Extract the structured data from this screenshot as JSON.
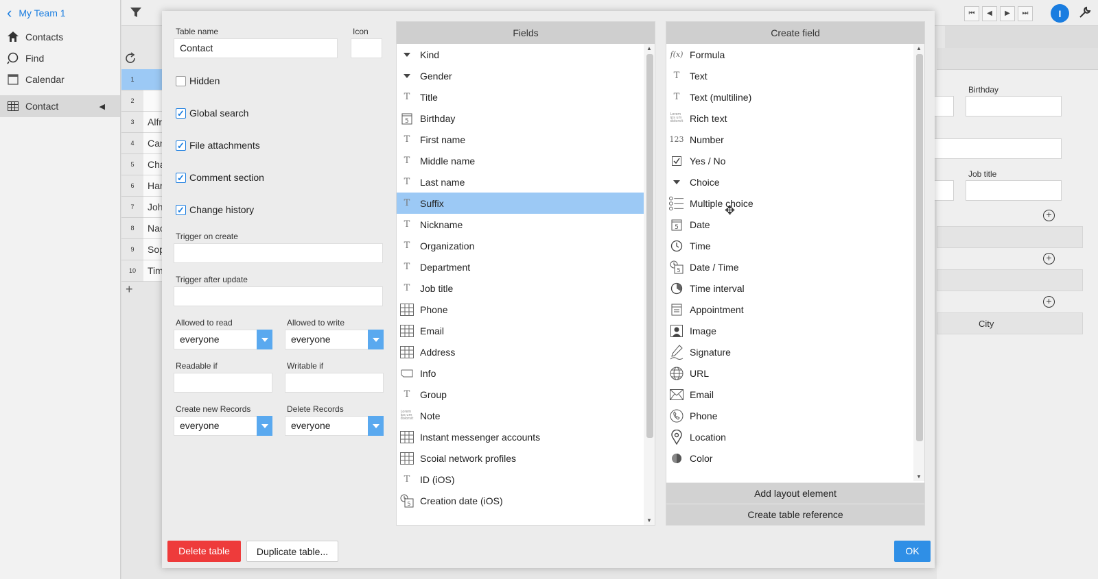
{
  "sidebar": {
    "back_label": "My Team 1",
    "items": [
      {
        "label": "Contacts",
        "icon": "home-icon"
      },
      {
        "label": "Find",
        "icon": "search-icon"
      },
      {
        "label": "Calendar",
        "icon": "calendar-icon"
      }
    ],
    "active_item": {
      "label": "Contact",
      "icon": "table-icon"
    }
  },
  "grid": {
    "rows": [
      {
        "num": "1",
        "text": ""
      },
      {
        "num": "2",
        "text": ""
      },
      {
        "num": "3",
        "text": "Alfr"
      },
      {
        "num": "4",
        "text": "Car"
      },
      {
        "num": "5",
        "text": "Cha"
      },
      {
        "num": "6",
        "text": "Har"
      },
      {
        "num": "7",
        "text": "Joh"
      },
      {
        "num": "8",
        "text": "Nac"
      },
      {
        "num": "9",
        "text": "Sop"
      },
      {
        "num": "10",
        "text": "Tim"
      }
    ],
    "add_label": "+"
  },
  "right_panel": {
    "birthday_label": "Birthday",
    "job_title_label": "Job title",
    "city_label": "City"
  },
  "top_bar": {
    "user_initial": "I"
  },
  "dialog": {
    "table_name_label": "Table name",
    "table_name_value": "Contact",
    "icon_label": "Icon",
    "hidden_label": "Hidden",
    "global_search_label": "Global search",
    "file_attachments_label": "File attachments",
    "comment_section_label": "Comment section",
    "change_history_label": "Change history",
    "trigger_on_create_label": "Trigger on create",
    "trigger_after_update_label": "Trigger after update",
    "allowed_to_read_label": "Allowed to read",
    "allowed_to_read_value": "everyone",
    "allowed_to_write_label": "Allowed to write",
    "allowed_to_write_value": "everyone",
    "readable_if_label": "Readable if",
    "writable_if_label": "Writable if",
    "create_new_records_label": "Create new Records",
    "create_new_records_value": "everyone",
    "delete_records_label": "Delete Records",
    "delete_records_value": "everyone",
    "fields_header": "Fields",
    "fields": [
      {
        "label": "Kind",
        "icon": "choice-arrow-icon"
      },
      {
        "label": "Gender",
        "icon": "choice-arrow-icon"
      },
      {
        "label": "Title",
        "icon": "text-icon"
      },
      {
        "label": "Birthday",
        "icon": "date-icon"
      },
      {
        "label": "First name",
        "icon": "text-icon"
      },
      {
        "label": "Middle name",
        "icon": "text-icon"
      },
      {
        "label": "Last name",
        "icon": "text-icon"
      },
      {
        "label": "Suffix",
        "icon": "text-icon",
        "selected": true
      },
      {
        "label": "Nickname",
        "icon": "text-icon"
      },
      {
        "label": "Organization",
        "icon": "text-icon"
      },
      {
        "label": "Department",
        "icon": "text-icon"
      },
      {
        "label": "Job title",
        "icon": "text-icon"
      },
      {
        "label": "Phone",
        "icon": "table-icon"
      },
      {
        "label": "Email",
        "icon": "table-icon"
      },
      {
        "label": "Address",
        "icon": "table-icon"
      },
      {
        "label": "Info",
        "icon": "info-icon"
      },
      {
        "label": "Group",
        "icon": "text-icon"
      },
      {
        "label": "Note",
        "icon": "rich-text-icon"
      },
      {
        "label": "Instant messenger accounts",
        "icon": "table-icon"
      },
      {
        "label": "Scoial network profiles",
        "icon": "table-icon"
      },
      {
        "label": "ID (iOS)",
        "icon": "text-icon"
      },
      {
        "label": "Creation date (iOS)",
        "icon": "date-time-icon"
      }
    ],
    "create_field_header": "Create field",
    "create_fields": [
      {
        "label": "Formula",
        "icon": "formula-icon"
      },
      {
        "label": "Text",
        "icon": "text-icon"
      },
      {
        "label": "Text (multiline)",
        "icon": "text-icon"
      },
      {
        "label": "Rich text",
        "icon": "rich-text-icon"
      },
      {
        "label": "Number",
        "icon": "number-icon"
      },
      {
        "label": "Yes / No",
        "icon": "checkbox-icon"
      },
      {
        "label": "Choice",
        "icon": "choice-arrow-icon"
      },
      {
        "label": "Multiple choice",
        "icon": "multiple-choice-icon"
      },
      {
        "label": "Date",
        "icon": "date-icon"
      },
      {
        "label": "Time",
        "icon": "clock-icon"
      },
      {
        "label": "Date / Time",
        "icon": "date-time-icon"
      },
      {
        "label": "Time interval",
        "icon": "time-interval-icon"
      },
      {
        "label": "Appointment",
        "icon": "appointment-icon"
      },
      {
        "label": "Image",
        "icon": "image-icon"
      },
      {
        "label": "Signature",
        "icon": "signature-icon"
      },
      {
        "label": "URL",
        "icon": "globe-icon"
      },
      {
        "label": "Email",
        "icon": "envelope-icon"
      },
      {
        "label": "Phone",
        "icon": "phone-icon"
      },
      {
        "label": "Location",
        "icon": "location-pin-icon"
      },
      {
        "label": "Color",
        "icon": "color-icon"
      }
    ],
    "add_layout_element_label": "Add layout element",
    "create_table_reference_label": "Create table reference",
    "delete_table_label": "Delete table",
    "duplicate_table_label": "Duplicate table...",
    "ok_label": "OK"
  },
  "colors": {
    "accent": "#1a7de0",
    "selected_row": "#9cc9f5",
    "delete_button": "#ee3b3b",
    "ok_button": "#2f8fe6"
  }
}
